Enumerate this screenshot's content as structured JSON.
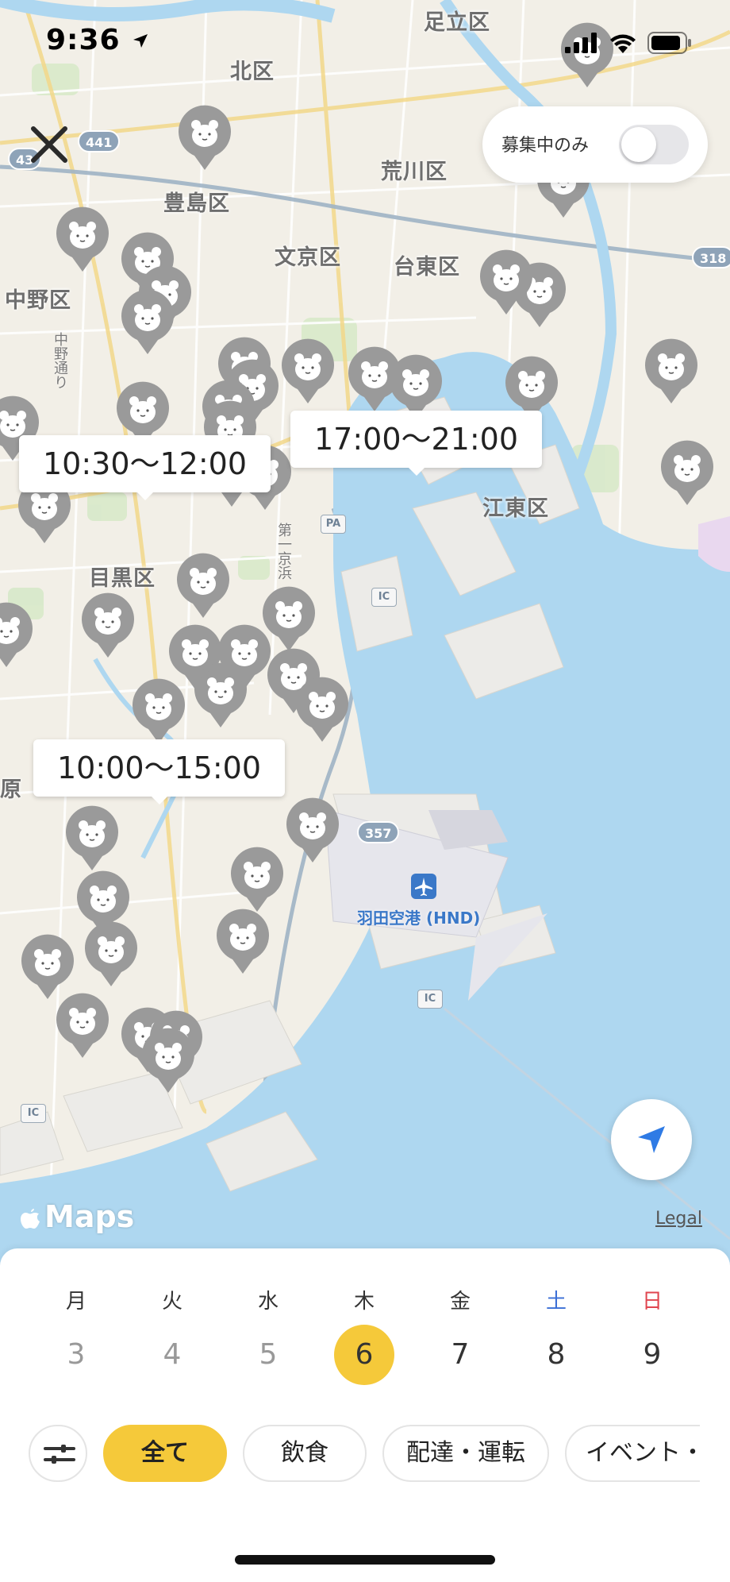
{
  "status_bar": {
    "time": "9:36"
  },
  "map": {
    "areas": [
      {
        "name": "足立区"
      },
      {
        "name": "北区"
      },
      {
        "name": "荒川区"
      },
      {
        "name": "豊島区"
      },
      {
        "name": "文京区"
      },
      {
        "name": "台東区"
      },
      {
        "name": "中野区"
      },
      {
        "name": "江東区"
      },
      {
        "name": "目黒区"
      },
      {
        "name": "原"
      }
    ],
    "streets": [
      {
        "name": "中野通り"
      },
      {
        "name": "第一京浜"
      }
    ],
    "shields": [
      {
        "num": "441"
      },
      {
        "num": "43"
      },
      {
        "num": "318"
      },
      {
        "num": "357"
      }
    ],
    "ic_labels": [
      "PA",
      "IC",
      "IC",
      "IC"
    ],
    "airport_label": "羽田空港 (HND)",
    "time_bubbles": [
      "10:30〜12:00",
      "17:00〜21:00",
      "10:00〜15:00"
    ],
    "logo_text": "Maps",
    "legal_text": "Legal"
  },
  "recruit_filter": {
    "label": "募集中のみ",
    "on": false
  },
  "calendar": {
    "days": [
      {
        "weekday": "月",
        "date": "3",
        "state": "past",
        "color": "#333333"
      },
      {
        "weekday": "火",
        "date": "4",
        "state": "past",
        "color": "#333333"
      },
      {
        "weekday": "水",
        "date": "5",
        "state": "past",
        "color": "#333333"
      },
      {
        "weekday": "木",
        "date": "6",
        "state": "selected",
        "color": "#333333"
      },
      {
        "weekday": "金",
        "date": "7",
        "state": "future",
        "color": "#333333"
      },
      {
        "weekday": "土",
        "date": "8",
        "state": "future",
        "color": "#3b6fd6"
      },
      {
        "weekday": "日",
        "date": "9",
        "state": "future",
        "color": "#e0454f"
      }
    ]
  },
  "categories": [
    {
      "label": "全て",
      "active": true
    },
    {
      "label": "飲食",
      "active": false
    },
    {
      "label": "配達・運転",
      "active": false
    },
    {
      "label": "イベント・",
      "active": false
    }
  ],
  "colors": {
    "accent": "#f5c93a",
    "water": "#aed7f0",
    "pin": "#9a9a9a",
    "locate": "#2f7be5"
  },
  "icons": {
    "close": "close-icon",
    "locate": "location-arrow-icon",
    "filter": "sliders-icon",
    "signal": "signal-icon",
    "wifi": "wifi-icon",
    "battery": "battery-icon",
    "location": "location-arrow-small-icon",
    "pin": "bear-pin-icon",
    "airport": "airplane-icon"
  }
}
